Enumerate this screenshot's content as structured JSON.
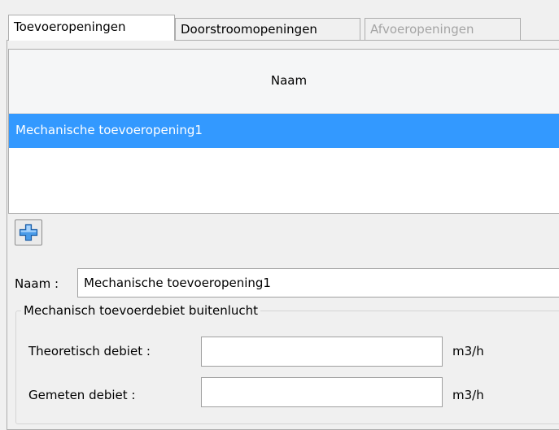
{
  "tabs": [
    {
      "label": "Toevoeropeningen",
      "state": "active"
    },
    {
      "label": "Doorstroomopeningen",
      "state": "normal"
    },
    {
      "label": "Afvoeropeningen",
      "state": "disabled"
    }
  ],
  "list": {
    "column_header": "Naam",
    "rows": [
      "Mechanische toevoeropening1"
    ],
    "selected_color": "#3399ff"
  },
  "add_button": {
    "icon": "plus-icon"
  },
  "name_field": {
    "label": "Naam :",
    "value": "Mechanische toevoeropening1"
  },
  "group": {
    "title": "Mechanisch toevoerdebiet buitenlucht",
    "fields": [
      {
        "label": "Theoretisch debiet :",
        "value": "",
        "unit": "m3/h"
      },
      {
        "label": "Gemeten debiet :",
        "value": "",
        "unit": "m3/h"
      }
    ]
  }
}
